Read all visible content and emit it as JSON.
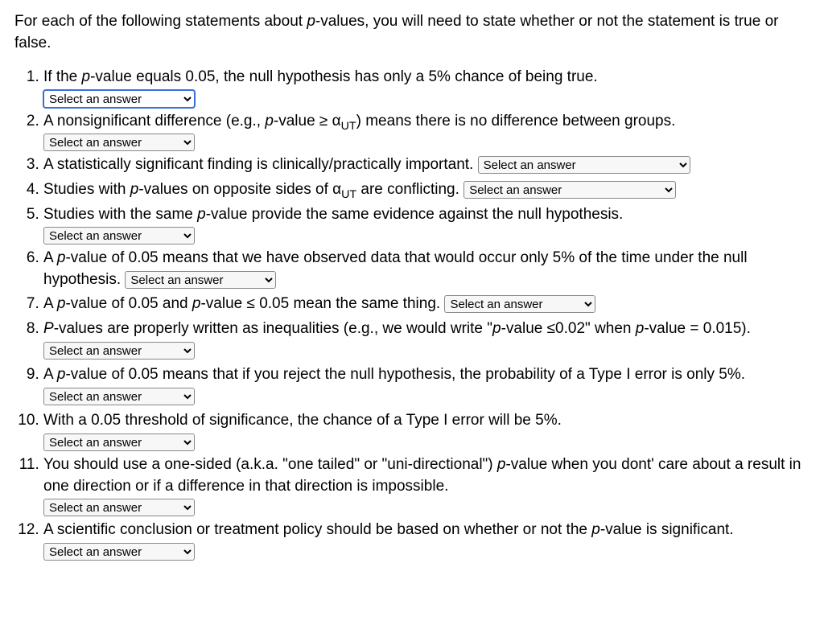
{
  "intro": "For each of the following statements about p-values, you will need to state whether or not the statement is true or false.",
  "select_placeholder": "Select an answer",
  "questions": [
    {
      "text_html": "If the <i>p</i>-value equals 0.05, the null hypothesis has only a 5% chance of being true.",
      "select_position": "below",
      "select_focused": true
    },
    {
      "text_html": "A nonsignificant difference (e.g., <i>p</i>-value ≥ α<span class='sub'>UT</span>) means there is no difference between groups.",
      "select_position": "below"
    },
    {
      "text_html": "A statistically significant finding is clinically/practically important.",
      "select_position": "inline",
      "select_wide": true
    },
    {
      "text_html": "Studies with <i>p</i>-values on opposite sides of α<span class='sub'>UT</span> are conflicting.",
      "select_position": "inline",
      "select_wide": true
    },
    {
      "text_html": "Studies with the same <i>p</i>-value provide the same evidence against the null hypothesis.",
      "select_position": "below"
    },
    {
      "text_html": "A <i>p</i>-value of 0.05 means that we have observed data that would occur only 5% of the time under the null hypothesis.",
      "select_position": "inline"
    },
    {
      "text_html": "A <i>p</i>-value of 0.05 and <i>p</i>-value ≤ 0.05 mean the same thing.",
      "select_position": "inline"
    },
    {
      "text_html": "<i>P</i>-values are properly written as inequalities (e.g., we would write \"<i>p</i>-value ≤0.02\" when <i>p</i>-value = 0.015).",
      "select_position": "inline"
    },
    {
      "text_html": "A <i>p</i>-value of 0.05 means that if you reject the null hypothesis, the probability of a Type I error is only 5%.",
      "select_position": "inline"
    },
    {
      "text_html": "With a 0.05 threshold of significance, the chance of a Type I error will be 5%.",
      "select_position": "below"
    },
    {
      "text_html": "You should use a one-sided (a.k.a. \"one tailed\" or \"uni-directional\") <i>p</i>-value when you dont' care about a result in one direction or if a difference in that direction is impossible.",
      "select_position": "below"
    },
    {
      "text_html": "A scientific conclusion or treatment policy should be based on whether or not the <i>p</i>-value is significant.",
      "select_position": "inline"
    }
  ]
}
